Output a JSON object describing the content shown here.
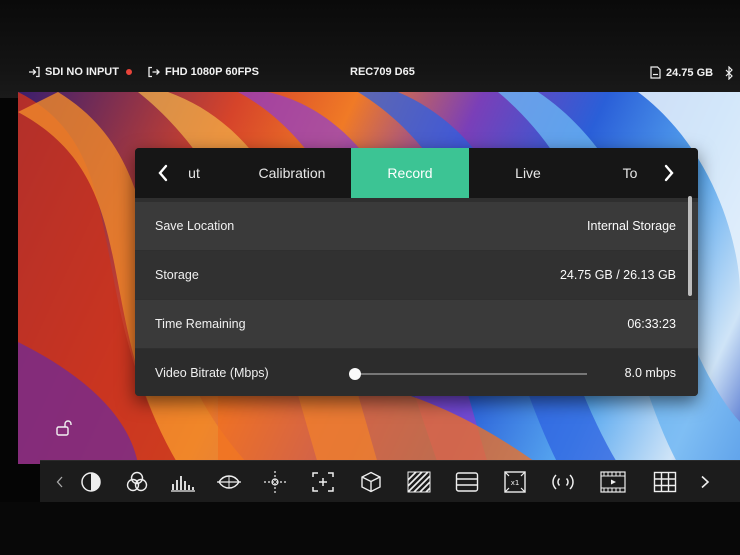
{
  "status_bar": {
    "input": "SDI NO INPUT",
    "format": "FHD 1080P 60FPS",
    "color_space": "REC709 D65",
    "storage": "24.75 GB",
    "rec_color": "#e8443a"
  },
  "menu": {
    "tabs": [
      {
        "label": "ut",
        "active": false
      },
      {
        "label": "Calibration",
        "active": false
      },
      {
        "label": "Record",
        "active": true
      },
      {
        "label": "Live",
        "active": false
      },
      {
        "label": "To",
        "active": false
      }
    ],
    "accent": "#3cc494",
    "rows": [
      {
        "label": "Save Location",
        "value": "Internal Storage"
      },
      {
        "label": "Storage",
        "value": "24.75 GB / 26.13 GB"
      },
      {
        "label": "Time Remaining",
        "value": "06:33:23"
      },
      {
        "label": "Video Bitrate (Mbps)",
        "value": "8.0 mbps",
        "slider_fraction": 0.0
      }
    ]
  },
  "toolbar": {
    "icons": [
      "chevron-left-icon",
      "false-color-icon",
      "rgb-overlay-icon",
      "histogram-icon",
      "vectorscope-icon",
      "crosshair-icon",
      "frame-guide-icon",
      "3d-lut-icon",
      "zebra-icon",
      "waveform-icon",
      "anamorphic-icon",
      "audio-icon",
      "filmstrip-icon",
      "grid-icon",
      "chevron-right-icon"
    ]
  }
}
